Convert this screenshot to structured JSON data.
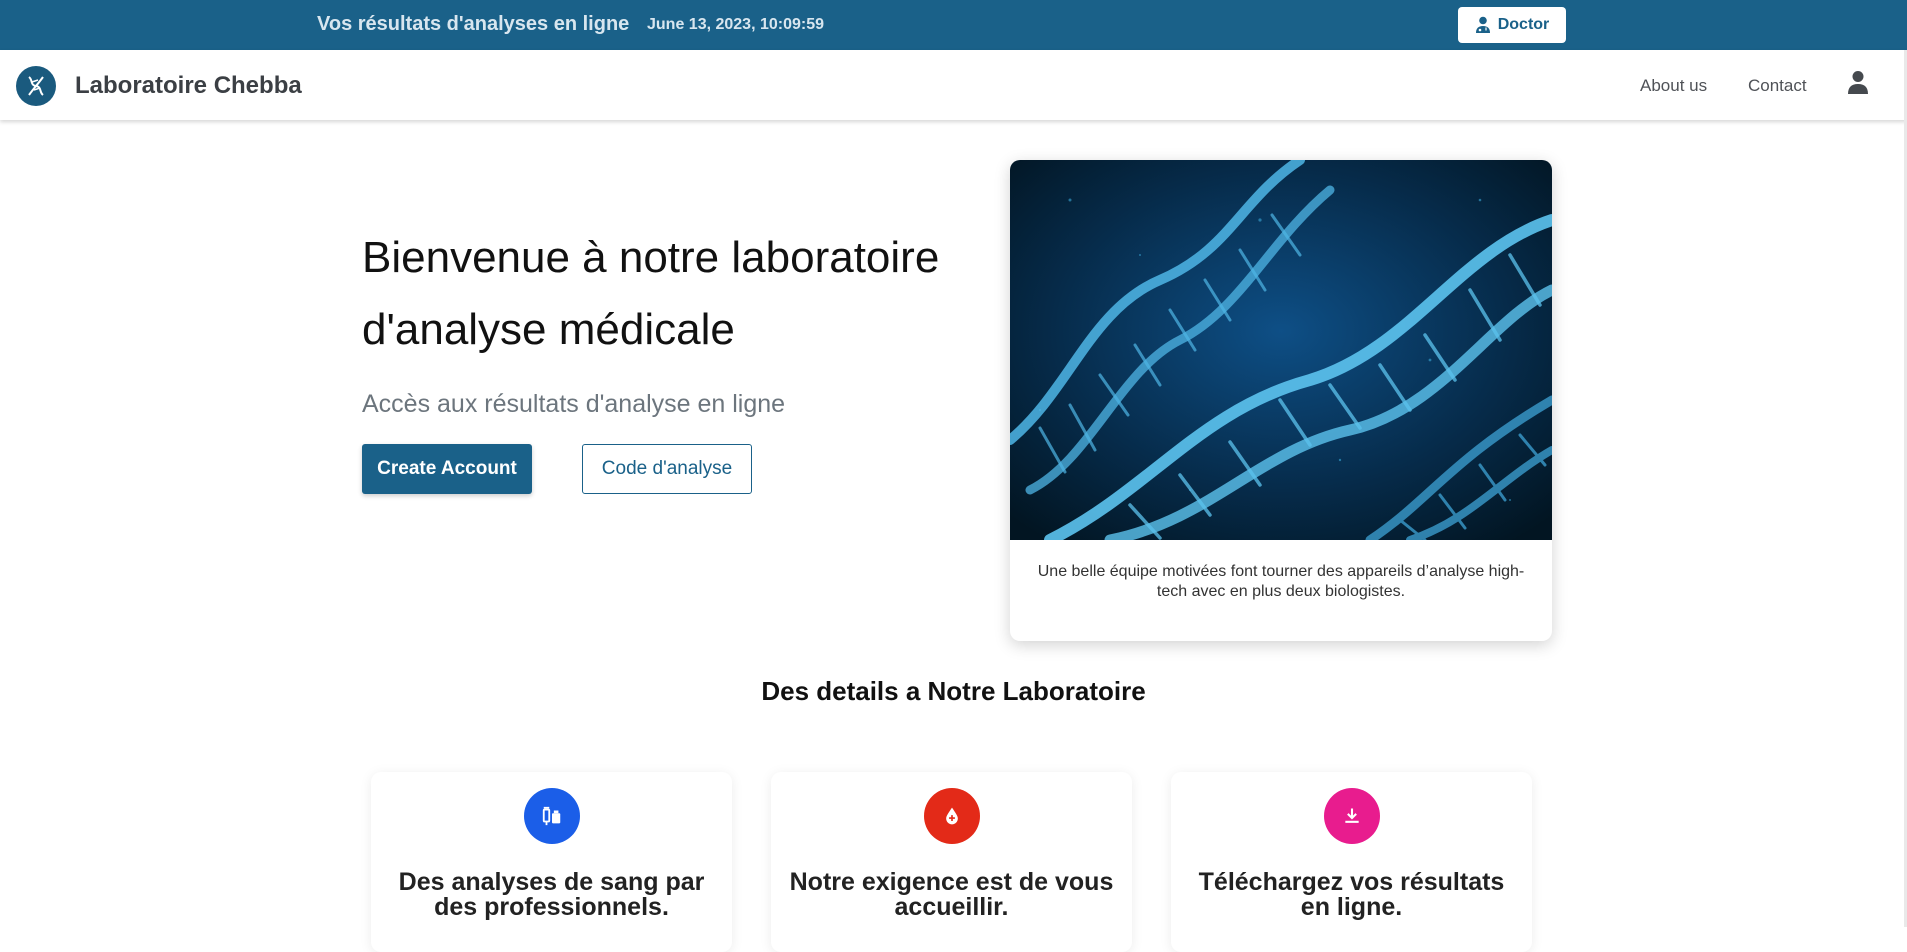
{
  "topbar": {
    "title": "Vos résultats d'analyses en ligne",
    "datetime": "June 13, 2023, 10:09:59",
    "doctor_label": "Doctor"
  },
  "navbar": {
    "brand": "Laboratoire Chebba",
    "links": [
      "About us",
      "Contact"
    ]
  },
  "hero": {
    "title": "Bienvenue à notre laboratoire d'analyse médicale",
    "subtitle": "Accès aux résultats d'analyse en ligne",
    "primary_button": "Create Account",
    "secondary_button": "Code d'analyse"
  },
  "card": {
    "caption": "Une belle équipe motivées font tourner des appareils d’analyse high-tech avec en plus deux biologistes."
  },
  "details": {
    "title": "Des details a Notre Laboratoire",
    "features": [
      {
        "icon": "syringe-vials-icon",
        "color": "#1b5ee8",
        "text": "Des analyses de sang par des professionnels."
      },
      {
        "icon": "blood-drop-icon",
        "color": "#e32a18",
        "text": "Notre exigence est de vous accueillir."
      },
      {
        "icon": "download-icon",
        "color": "#e81c8e",
        "text": "Téléchargez vos résultats en ligne."
      }
    ]
  },
  "colors": {
    "brand": "#1a6189",
    "topbar_bg": "#1a6189"
  }
}
